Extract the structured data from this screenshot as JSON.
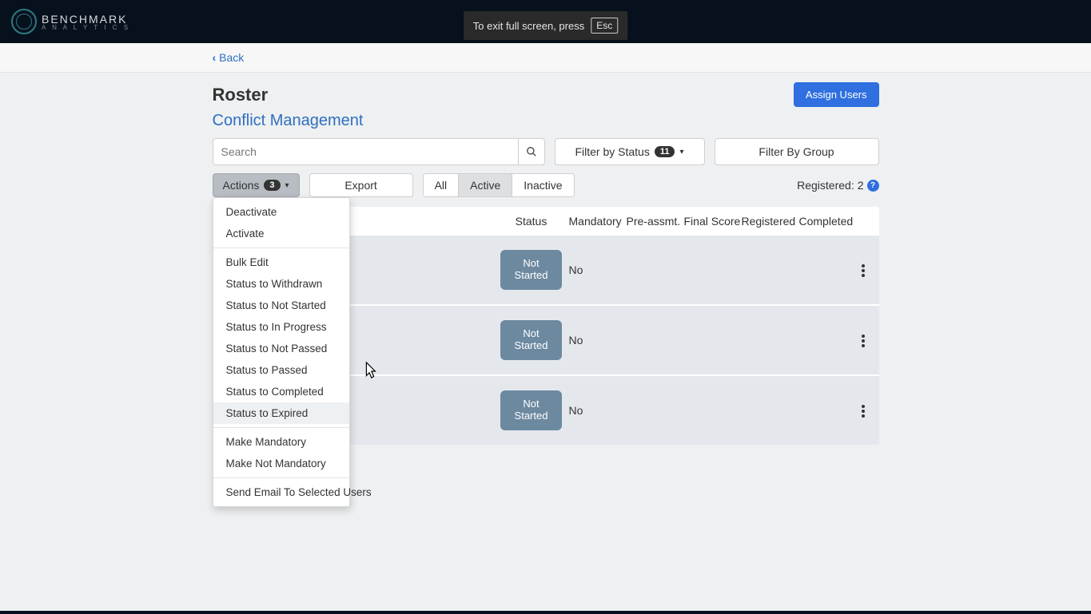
{
  "brand": {
    "name": "BENCHMARK",
    "sub": "A N A L Y T I C S"
  },
  "fullscreen_hint": {
    "text": "To exit full screen, press",
    "key": "Esc"
  },
  "nav": {
    "back_label": "Back"
  },
  "page": {
    "title": "Roster",
    "subtitle": "Conflict Management"
  },
  "buttons": {
    "assign_users": "Assign Users",
    "export": "Export"
  },
  "search": {
    "placeholder": "Search"
  },
  "filters": {
    "status_label": "Filter by Status",
    "status_count": "11",
    "group_label": "Filter By Group"
  },
  "actions_btn": {
    "label": "Actions",
    "count": "3"
  },
  "tabs": {
    "all": "All",
    "active": "Active",
    "inactive": "Inactive"
  },
  "registered": {
    "label": "Registered:",
    "count": "2"
  },
  "actions_menu": {
    "group1": [
      "Deactivate",
      "Activate"
    ],
    "group2": [
      "Bulk Edit",
      "Status to Withdrawn",
      "Status to Not Started",
      "Status to In Progress",
      "Status to Not Passed",
      "Status to Passed",
      "Status to Completed",
      "Status to Expired"
    ],
    "group3": [
      "Make Mandatory",
      "Make Not Mandatory"
    ],
    "group4": [
      "Send Email To Selected Users"
    ],
    "highlighted": "Status to Expired"
  },
  "table": {
    "headers": {
      "status": "Status",
      "mandatory": "Mandatory",
      "pre_assmt": "Pre-assmt.",
      "final_score": "Final Score",
      "registered": "Registered",
      "completed": "Completed"
    },
    "rows": [
      {
        "status": "Not Started",
        "mandatory": "No",
        "pre_assmt": "",
        "final_score": "",
        "registered": "",
        "completed": ""
      },
      {
        "status": "Not Started",
        "mandatory": "No",
        "pre_assmt": "",
        "final_score": "",
        "registered": "",
        "completed": ""
      },
      {
        "status": "Not Started",
        "mandatory": "No",
        "pre_assmt": "",
        "final_score": "",
        "registered": "",
        "completed": ""
      }
    ]
  }
}
